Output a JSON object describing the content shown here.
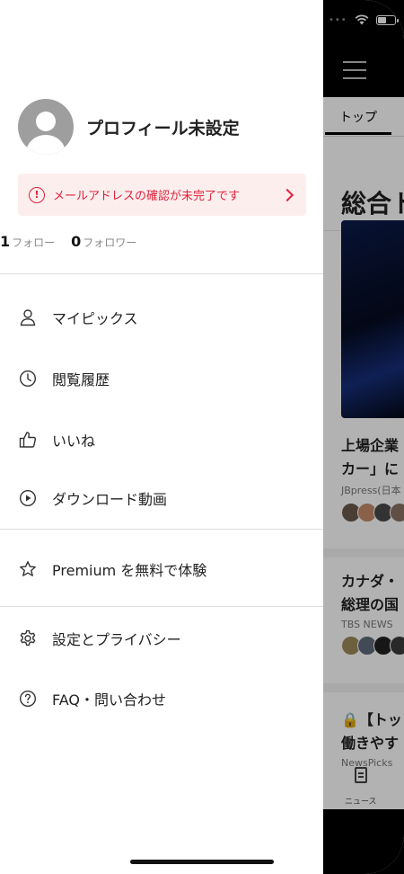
{
  "background_app": {
    "tab_top": "トップ",
    "section_title": "総合ト",
    "articles": [
      {
        "title_line1": "上場企業",
        "title_line2": "カー」に",
        "source": "JBpress(日本"
      },
      {
        "title_line1": "カナダ・",
        "title_line2": "総理の国",
        "source": "TBS NEWS"
      },
      {
        "title_line1": "🔒【トッ",
        "title_line2": "働きやす",
        "source": "NewsPicks"
      }
    ],
    "bottom_tab_news": "ニュース"
  },
  "profile": {
    "name": "プロフィール未設定"
  },
  "alert": {
    "text": "メールアドレスの確認が未完了です",
    "color": "#e0223a"
  },
  "stats": {
    "follow_count": "1",
    "follow_label": "フォロー",
    "follower_count": "0",
    "follower_label": "フォロワー"
  },
  "menu": {
    "my_picks": "マイピックス",
    "history": "閲覧履歴",
    "likes": "いいね",
    "downloads": "ダウンロード動画",
    "premium": "Premium を無料で体験",
    "settings": "設定とプライバシー",
    "faq": "FAQ・問い合わせ"
  }
}
